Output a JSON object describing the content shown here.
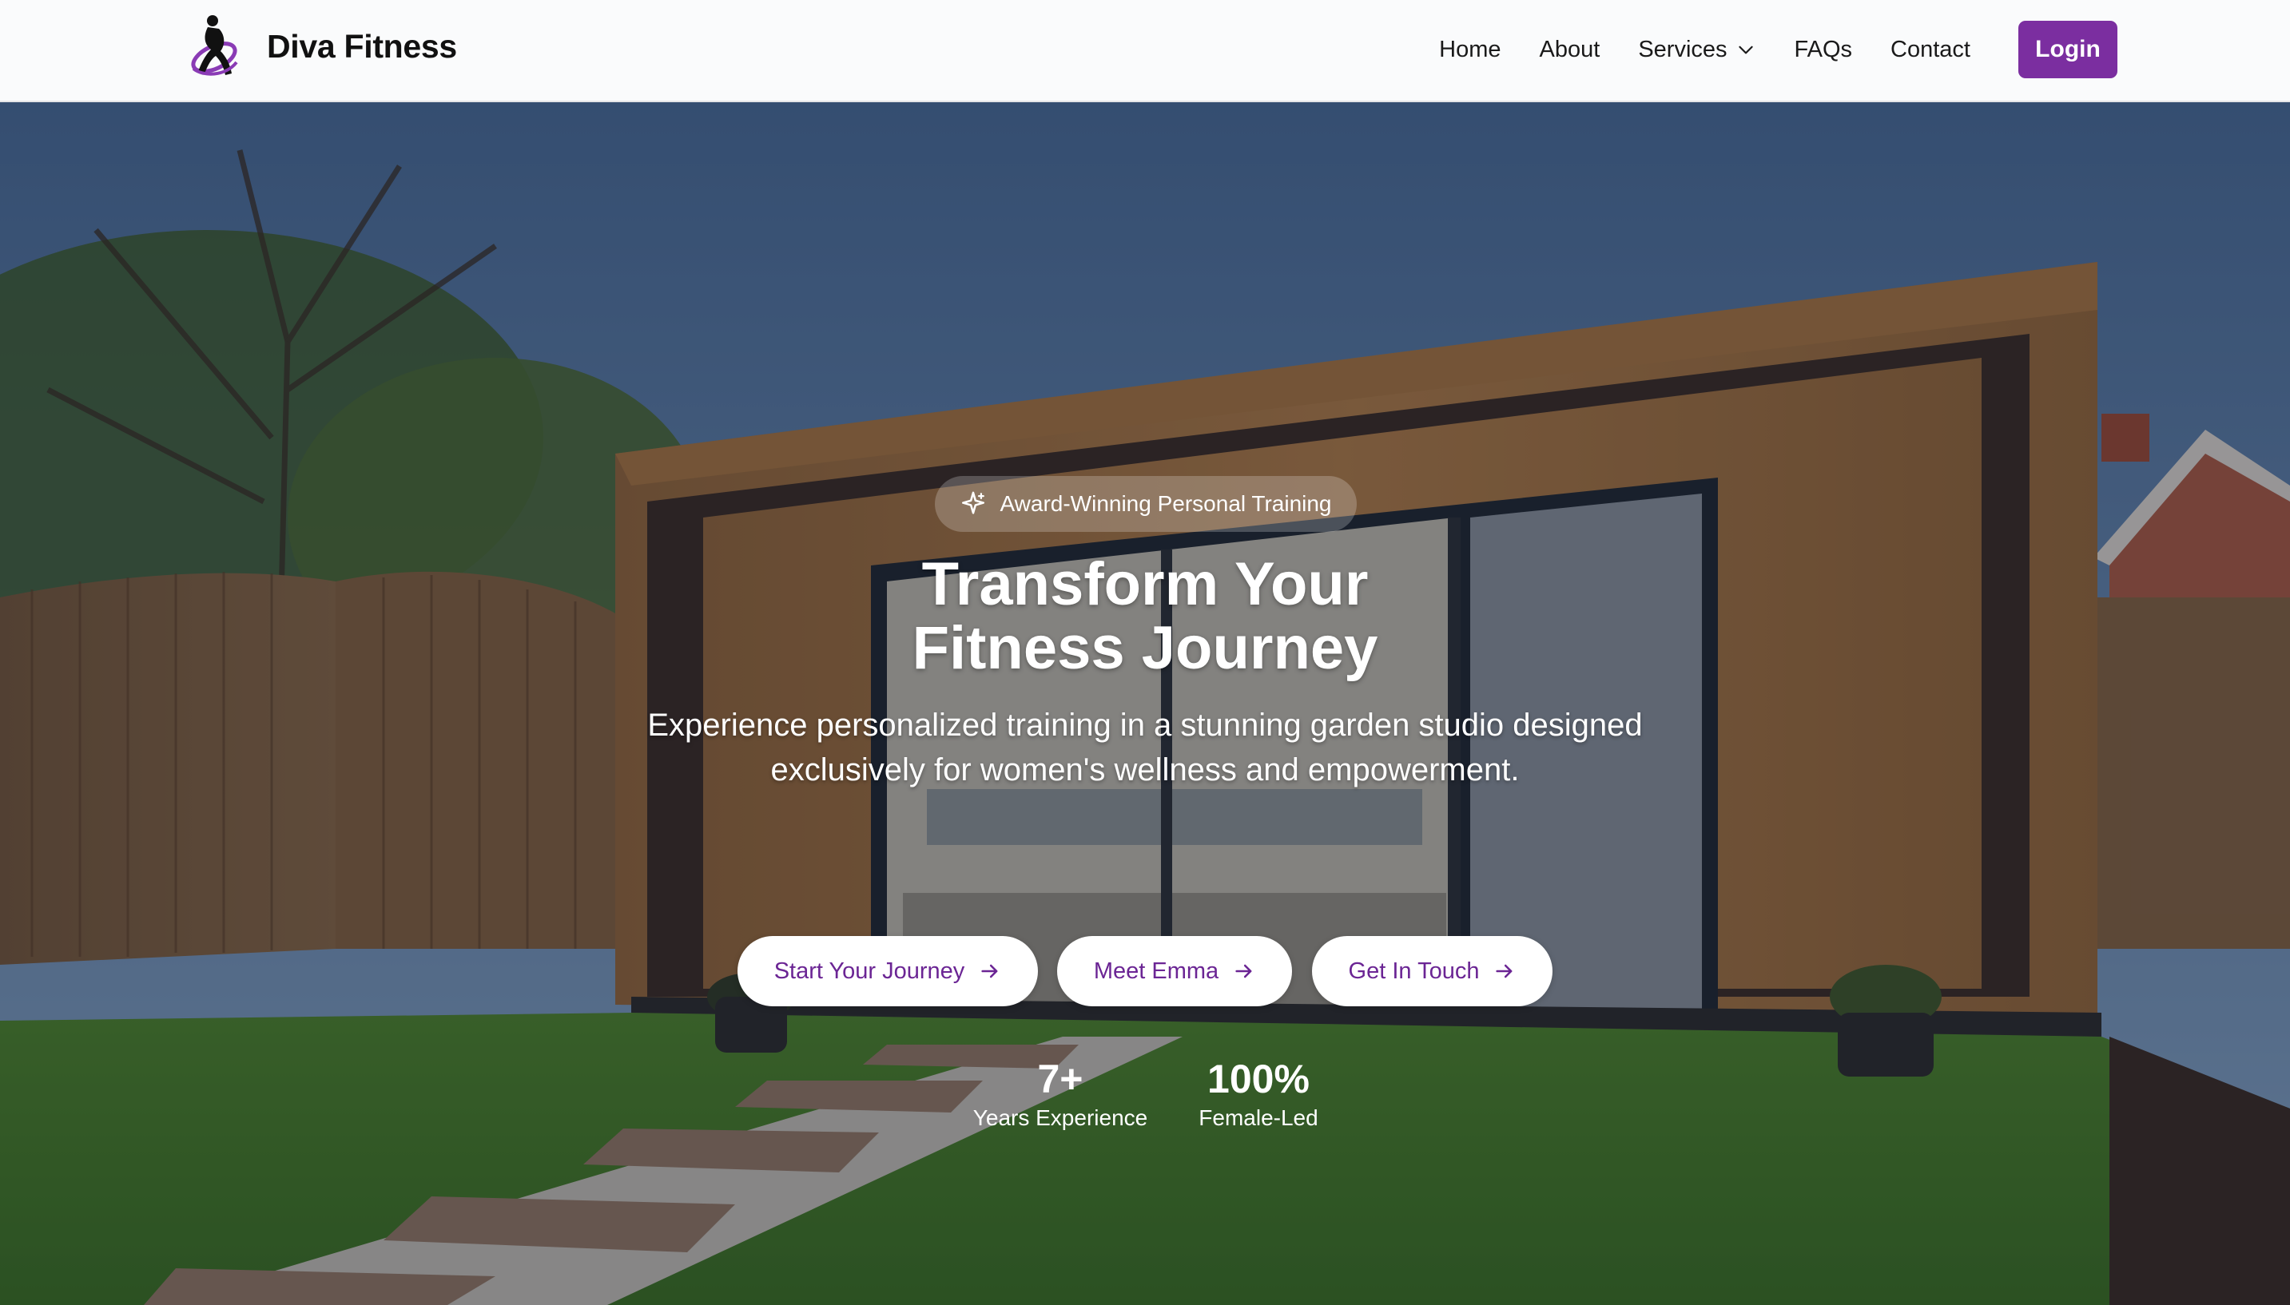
{
  "brand": {
    "name": "Diva Fitness",
    "logo_icon": "dancer-logo-icon"
  },
  "nav": {
    "links": [
      "Home",
      "About",
      "Services",
      "FAQs",
      "Contact"
    ],
    "services_icon": "chevron-down-icon",
    "login_label": "Login"
  },
  "hero": {
    "badge": {
      "icon": "sparkle-icon",
      "text": "Award-Winning Personal Training"
    },
    "title_line1": "Transform Your",
    "title_line2": "Fitness Journey",
    "subtitle": "Experience personalized training in a stunning garden studio designed exclusively for women's wellness and empowerment.",
    "ctas": [
      {
        "label": "Start Your Journey",
        "icon": "arrow-right-icon"
      },
      {
        "label": "Meet Emma",
        "icon": "arrow-right-icon"
      },
      {
        "label": "Get In Touch",
        "icon": "arrow-right-icon"
      }
    ],
    "stats": [
      {
        "value": "7+",
        "label": "Years Experience"
      },
      {
        "value": "100%",
        "label": "Female-Led"
      }
    ]
  },
  "colors": {
    "accent": "#7b2ea0",
    "cta_text": "#6b2594",
    "navbar_bg": "#fafbfc"
  }
}
